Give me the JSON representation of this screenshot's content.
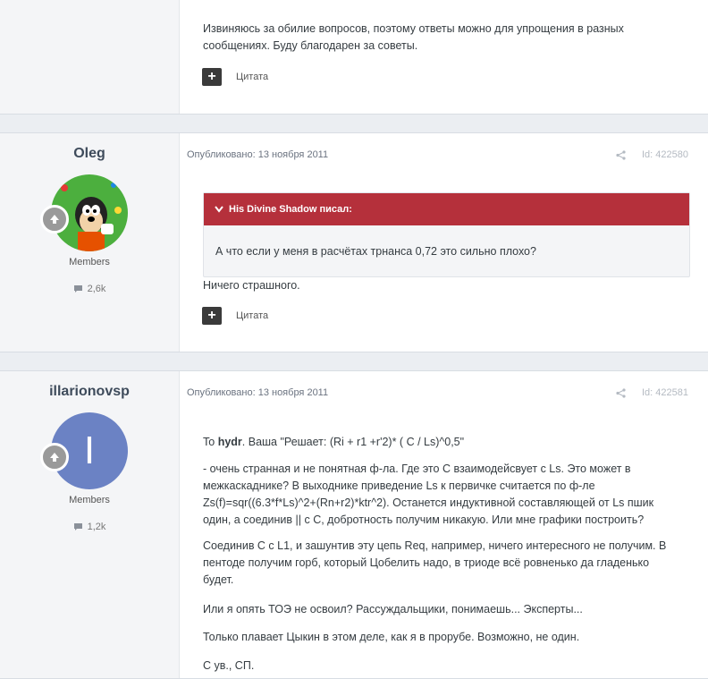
{
  "post1": {
    "text": "Извиняюсь за обилие вопросов, поэтому ответы можно для упрощения в разных сообщениях. Буду благодарен за советы.",
    "quote_action": "Цитата"
  },
  "post2": {
    "author": "Oleg",
    "group": "Members",
    "post_count": "2,6k",
    "published": "Опубликовано: 13 ноября 2011",
    "post_id": "Id: 422580",
    "quote": {
      "author_line": "His Divine Shadow писал:",
      "text": "А что если у меня в расчётах трнанса 0,72 это сильно плохо?"
    },
    "text": "Ничего страшного.",
    "quote_action": "Цитата"
  },
  "post3": {
    "author": "illarionovsp",
    "avatar_letter": "I",
    "group": "Members",
    "post_count": "1,2k",
    "published": "Опубликовано: 13 ноября 2011",
    "post_id": "Id: 422581",
    "p1_prefix": "To ",
    "p1_user": "hydr",
    "p1_rest": ". Ваша \"Решает: (Ri + r1 +r'2)* ( C / Ls)^0,5\"",
    "p2": "- очень странная и не понятная ф-ла. Где это С взаимодейсвует с Ls. Это может в межкаскаднике? В выходнике приведение Ls к первичке считается по ф-ле Zs(f)=sqr((6.3*f*Ls)^2+(Rn+r2)*ktr^2). Останется индуктивной составляющей от Ls пшик один, а соединив || с С, добротность получим никакую. Или мне графики построить?",
    "p3": "Соединив С с L1, и зашунтив эту цепь Req, например, ничего интересного не получим. В пентоде получим горб, который Цобелить надо, в триоде всё ровненько да гладенько будет.",
    "p4": "Или я опять ТОЭ не освоил? Рассуждальщики, понимаешь... Эксперты...",
    "p5": "Только плавает Цыкин в этом деле, как я в прорубе. Возможно, не один.",
    "p6": "С ув., СП."
  },
  "colors": {
    "quote_header": "#b5303b",
    "avatar_blue": "#6b82c4",
    "page_bg": "#ebeef2"
  }
}
